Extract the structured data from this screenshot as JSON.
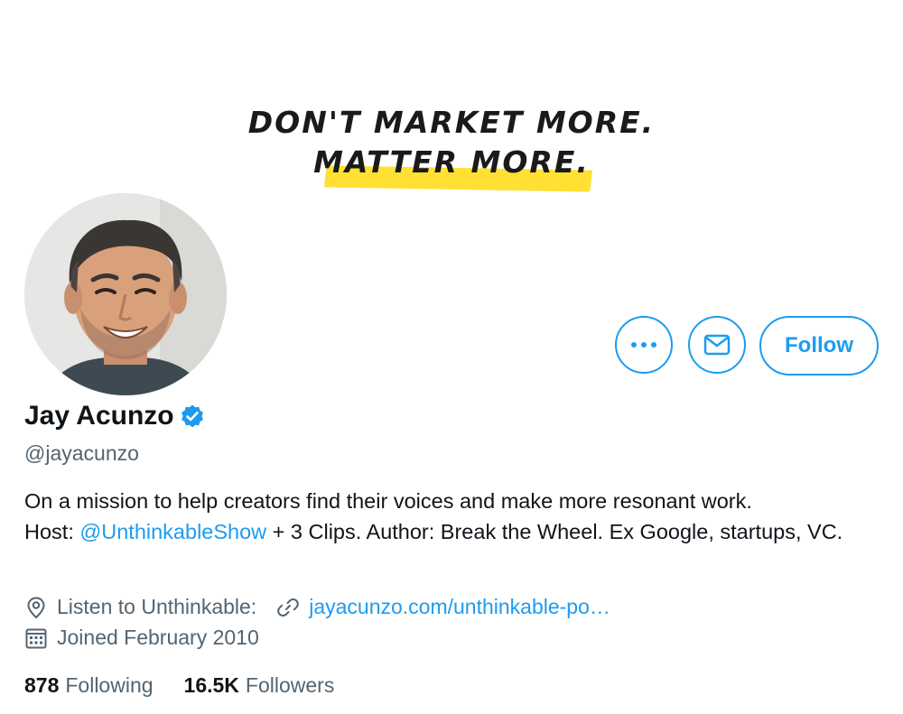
{
  "banner": {
    "line1": "DON'T MARKET MORE.",
    "line2": "MATTER MORE.",
    "highlight_color": "#ffe033"
  },
  "profile": {
    "name": "Jay Acunzo",
    "verified": true,
    "handle": "@jayacunzo",
    "avatar_icon": "profile-photo"
  },
  "actions": {
    "more_icon": "more-icon",
    "message_icon": "envelope-icon",
    "follow_label": "Follow"
  },
  "bio": {
    "line1": "On a mission to help creators find their voices and make more resonant work.",
    "host_prefix": "Host: ",
    "mention": "@UnthinkableShow",
    "rest": " + 3 Clips. Author: Break the Wheel. Ex Google, startups, VC."
  },
  "meta": {
    "location": "Listen to Unthinkable:",
    "link": "jayacunzo.com/unthinkable-po…",
    "joined": "Joined February 2010"
  },
  "counts": {
    "following_num": "878",
    "following_label": "Following",
    "followers_num": "16.5K",
    "followers_label": "Followers"
  },
  "colors": {
    "accent": "#1d9bf0",
    "secondary_text": "#536471",
    "primary_text": "#0f1419"
  }
}
